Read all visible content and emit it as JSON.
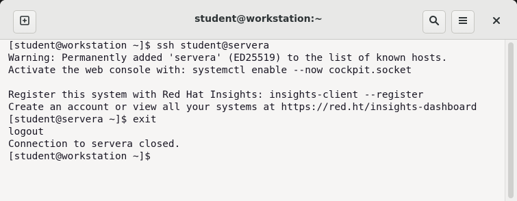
{
  "window": {
    "title": "student@workstation:~"
  },
  "icons": {
    "new_tab": "new-tab-icon",
    "search": "search-icon",
    "menu": "hamburger-menu-icon",
    "close": "close-icon"
  },
  "terminal": {
    "lines": [
      "[student@workstation ~]$ ssh student@servera",
      "Warning: Permanently added 'servera' (ED25519) to the list of known hosts.",
      "Activate the web console with: systemctl enable --now cockpit.socket",
      "",
      "Register this system with Red Hat Insights: insights-client --register",
      "Create an account or view all your systems at https://red.ht/insights-dashboard",
      "[student@servera ~]$ exit",
      "logout",
      "Connection to servera closed.",
      "[student@workstation ~]$ "
    ]
  },
  "colors": {
    "terminal_bg": "#f6f5f4",
    "terminal_fg": "#171421",
    "titlebar_bg": "#e8e8e7"
  }
}
